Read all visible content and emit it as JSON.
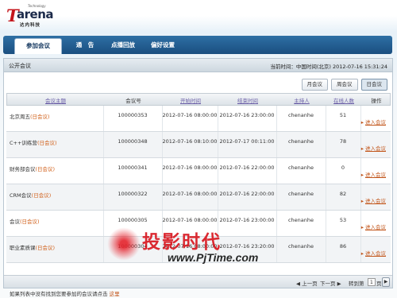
{
  "logo": {
    "main_t": "T",
    "main_rest": "arena",
    "tech": "Technology",
    "cn": "达内科技"
  },
  "nav": {
    "items": [
      "参加会议",
      "通　告",
      "点播回放",
      "偏好设置"
    ]
  },
  "panel": {
    "title": "公开会议",
    "time": "当前时间：中国时间(北京)  2012-07-16 15:31:24"
  },
  "tabs": [
    "月会议",
    "周会议",
    "日会议"
  ],
  "table": {
    "headers": [
      "会议主题",
      "会议号",
      "开始时间",
      "结束时间",
      "主持人",
      "在线人数",
      "操作"
    ],
    "rows": [
      {
        "topic": "北京周五",
        "tag": "(日会议)",
        "id": "100000353",
        "start": "2012-07-16 08:00:00",
        "end": "2012-07-16 23:00:00",
        "host": "chenanhe",
        "online": "51",
        "action": "进入会议"
      },
      {
        "topic": "C++训练营",
        "tag": "(日会议)",
        "id": "100000348",
        "start": "2012-07-16 08:10:00",
        "end": "2012-07-17 00:11:00",
        "host": "chenanhe",
        "online": "78",
        "action": "进入会议"
      },
      {
        "topic": "财务部会议",
        "tag": "(日会议)",
        "id": "100000341",
        "start": "2012-07-16 08:00:00",
        "end": "2012-07-16 22:00:00",
        "host": "chenanhe",
        "online": "0",
        "action": "进入会议"
      },
      {
        "topic": "CRM会议",
        "tag": "(日会议)",
        "id": "100000322",
        "start": "2012-07-16 08:00:00",
        "end": "2012-07-16 22:00:00",
        "host": "chenanhe",
        "online": "82",
        "action": "进入会议"
      },
      {
        "topic": "会议",
        "tag": "(日会议)",
        "id": "100000305",
        "start": "2012-07-16 08:00:00",
        "end": "2012-07-16 23:00:00",
        "host": "chenanhe",
        "online": "53",
        "action": "进入会议"
      },
      {
        "topic": "职业素质课",
        "tag": "(日会议)",
        "id": "100000304",
        "start": "2012-07-16 08:00:00",
        "end": "2012-07-16 23:20:00",
        "host": "chenanhe",
        "online": "86",
        "action": "进入会议"
      }
    ]
  },
  "pager": {
    "prev": "◀ 上一页",
    "next": "下一页 ▶",
    "goto": "转到第",
    "page": "1",
    "unit": "页",
    "go": "▶"
  },
  "footer": {
    "text": "如果列表中没有找到您要参加的会议请点击 ",
    "link": "这里"
  },
  "watermark": {
    "cn": "投影时代",
    "url": "www.PjTime.com"
  }
}
